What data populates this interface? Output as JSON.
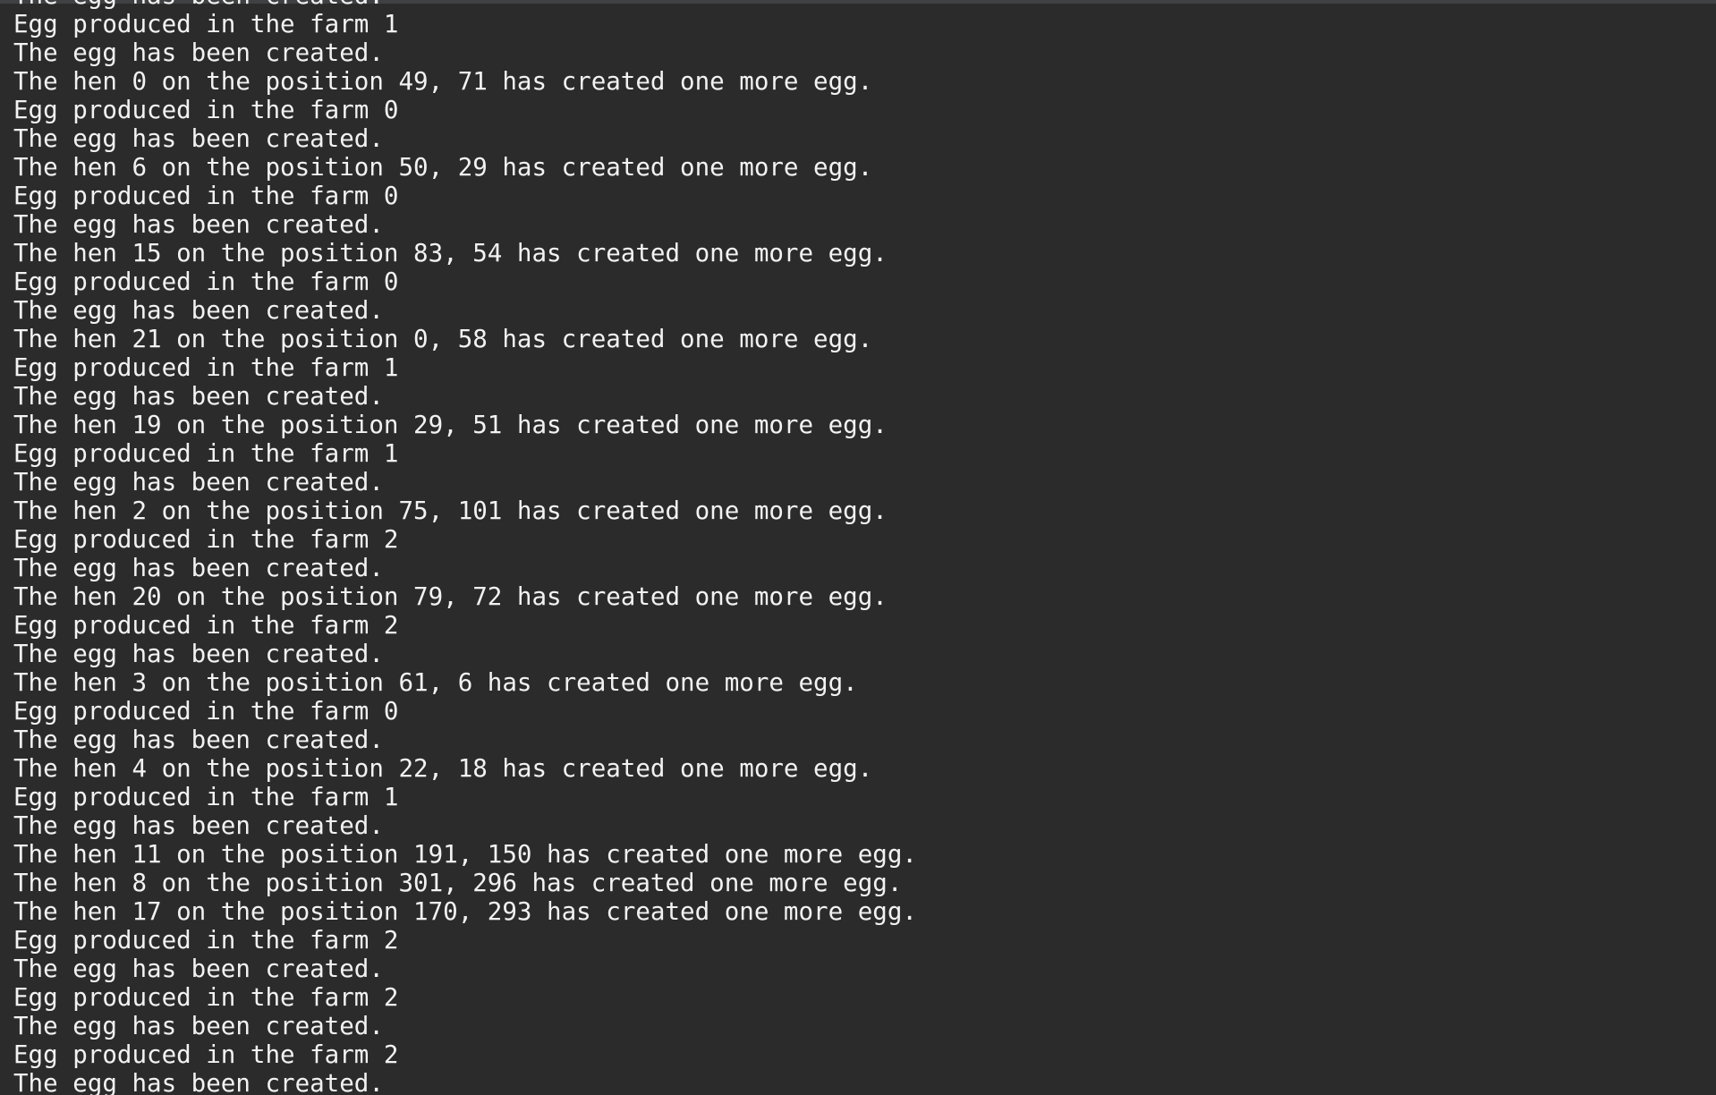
{
  "console": {
    "lines": [
      "The egg has been created.",
      "Egg produced in the farm 1",
      "The egg has been created.",
      "The hen 0 on the position 49, 71 has created one more egg.",
      "Egg produced in the farm 0",
      "The egg has been created.",
      "The hen 6 on the position 50, 29 has created one more egg.",
      "Egg produced in the farm 0",
      "The egg has been created.",
      "The hen 15 on the position 83, 54 has created one more egg.",
      "Egg produced in the farm 0",
      "The egg has been created.",
      "The hen 21 on the position 0, 58 has created one more egg.",
      "Egg produced in the farm 1",
      "The egg has been created.",
      "The hen 19 on the position 29, 51 has created one more egg.",
      "Egg produced in the farm 1",
      "The egg has been created.",
      "The hen 2 on the position 75, 101 has created one more egg.",
      "Egg produced in the farm 2",
      "The egg has been created.",
      "The hen 20 on the position 79, 72 has created one more egg.",
      "Egg produced in the farm 2",
      "The egg has been created.",
      "The hen 3 on the position 61, 6 has created one more egg.",
      "Egg produced in the farm 0",
      "The egg has been created.",
      "The hen 4 on the position 22, 18 has created one more egg.",
      "Egg produced in the farm 1",
      "The egg has been created.",
      "The hen 11 on the position 191, 150 has created one more egg.",
      "The hen 8 on the position 301, 296 has created one more egg.",
      "The hen 17 on the position 170, 293 has created one more egg.",
      "Egg produced in the farm 2",
      "The egg has been created.",
      "Egg produced in the farm 2",
      "The egg has been created.",
      "Egg produced in the farm 2",
      "The egg has been created."
    ]
  }
}
